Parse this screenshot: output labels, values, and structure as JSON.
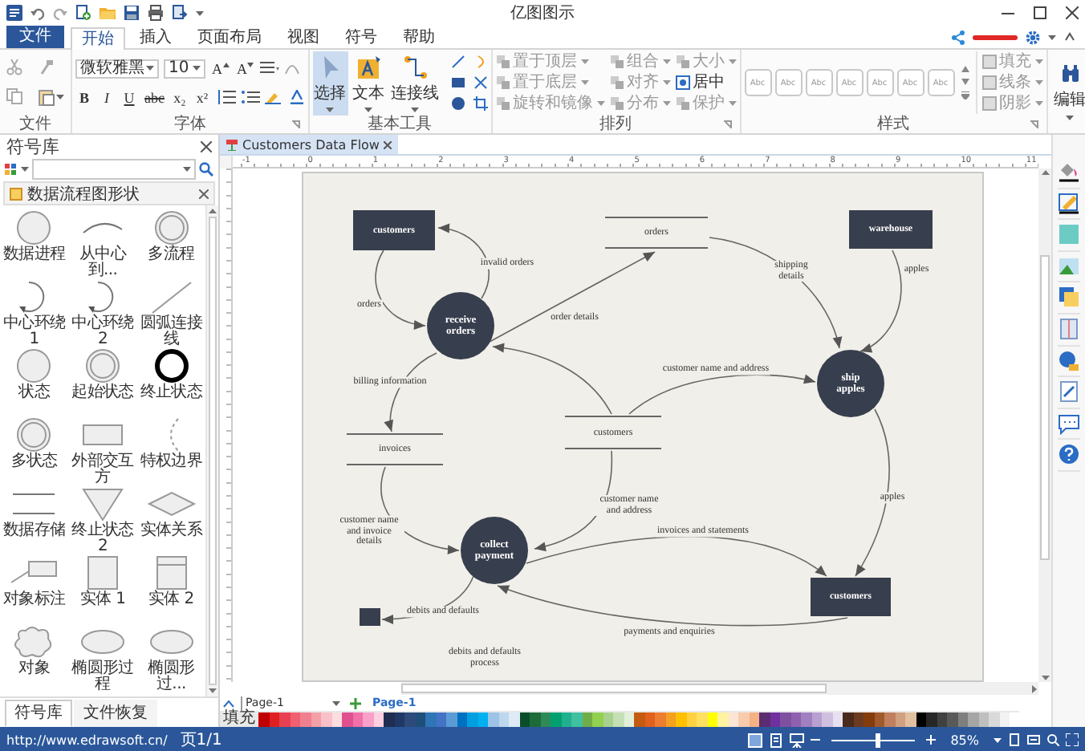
{
  "window": {
    "title": "亿图图示"
  },
  "file_button": "文件",
  "tabs": [
    {
      "label": "开始",
      "selected": true
    },
    {
      "label": "插入",
      "selected": false
    },
    {
      "label": "页面布局",
      "selected": false
    },
    {
      "label": "视图",
      "selected": false
    },
    {
      "label": "符号",
      "selected": false
    },
    {
      "label": "帮助",
      "selected": false
    }
  ],
  "ribbon": {
    "groups": [
      {
        "kind": "clipboard",
        "label": "文件"
      },
      {
        "kind": "font",
        "label": "字体",
        "font_name": "微软雅黑",
        "font_size": "10",
        "size_buttons": [
          "A",
          "A"
        ],
        "format_buttons": [
          "B",
          "I",
          "U",
          "abc",
          "x₂",
          "x²"
        ]
      },
      {
        "kind": "tools",
        "label": "基本工具",
        "tools": [
          {
            "label": "选择",
            "selected": true
          },
          {
            "label": "文本",
            "selected": false
          },
          {
            "label": "连接线",
            "selected": false
          }
        ]
      },
      {
        "kind": "arrange",
        "label": "排列",
        "buttons": [
          {
            "label": "置于顶层",
            "disabled": true,
            "dropdown": true
          },
          {
            "label": "置于底层",
            "disabled": true,
            "dropdown": true
          },
          {
            "label": "旋转和镜像",
            "disabled": true,
            "dropdown": true
          },
          {
            "label": "组合",
            "disabled": true,
            "dropdown": true
          },
          {
            "label": "对齐",
            "disabled": true,
            "dropdown": true
          },
          {
            "label": "分布",
            "disabled": true,
            "dropdown": true
          },
          {
            "label": "大小",
            "disabled": true,
            "dropdown": true
          },
          {
            "label": "居中",
            "disabled": false,
            "dropdown": false
          },
          {
            "label": "保护",
            "disabled": true,
            "dropdown": true
          }
        ]
      },
      {
        "kind": "styles",
        "label": "样式",
        "swatches": [
          "Abc",
          "Abc",
          "Abc",
          "Abc",
          "Abc",
          "Abc",
          "Abc"
        ],
        "format_buttons": [
          {
            "label": "填充",
            "disabled": true
          },
          {
            "label": "线条",
            "disabled": true
          },
          {
            "label": "阴影",
            "disabled": true
          }
        ]
      },
      {
        "kind": "edit",
        "button": "编辑"
      }
    ]
  },
  "library": {
    "title": "符号库",
    "category": "数据流程图形状",
    "shapes": [
      {
        "label": "数据进程",
        "kind": "circle"
      },
      {
        "label": "从中心到...",
        "kind": "arc"
      },
      {
        "label": "多流程",
        "kind": "double-circle"
      },
      {
        "label": "中心环绕 1",
        "kind": "loop"
      },
      {
        "label": "中心环绕 2",
        "kind": "loop"
      },
      {
        "label": "圆弧连接线",
        "kind": "diagonal"
      },
      {
        "label": "状态",
        "kind": "circle"
      },
      {
        "label": "起始状态",
        "kind": "double-circle"
      },
      {
        "label": "终止状态",
        "kind": "thick-circle"
      },
      {
        "label": "多状态",
        "kind": "double-circle"
      },
      {
        "label": "外部交互方",
        "kind": "rect"
      },
      {
        "label": "特权边界",
        "kind": "dashed-arc"
      },
      {
        "label": "数据存储",
        "kind": "store"
      },
      {
        "label": "终止状态 2",
        "kind": "triangle"
      },
      {
        "label": "实体关系",
        "kind": "diamond"
      },
      {
        "label": "对象标注",
        "kind": "callout"
      },
      {
        "label": "实体 1",
        "kind": "square"
      },
      {
        "label": "实体 2",
        "kind": "split-square"
      },
      {
        "label": "对象",
        "kind": "cloud"
      },
      {
        "label": "椭圆形过程",
        "kind": "ellipse"
      },
      {
        "label": "椭圆形过...",
        "kind": "ellipse"
      }
    ],
    "tabs": [
      {
        "label": "符号库",
        "selected": true
      },
      {
        "label": "文件恢复",
        "selected": false
      }
    ]
  },
  "document": {
    "tab": "Customers Data Flow",
    "ruler_labels": [
      "-1",
      "0",
      "1",
      "2",
      "3",
      "4",
      "5",
      "6",
      "7",
      "8",
      "9",
      "10",
      "11"
    ]
  },
  "diagram": {
    "nodes": [
      {
        "kind": "entity",
        "label": "customers"
      },
      {
        "kind": "store",
        "label": "orders"
      },
      {
        "kind": "entity",
        "label": "warehouse"
      },
      {
        "kind": "process",
        "label": "receive orders"
      },
      {
        "kind": "process",
        "label": "ship apples"
      },
      {
        "kind": "store",
        "label": "invoices"
      },
      {
        "kind": "store",
        "label": "customers"
      },
      {
        "kind": "process",
        "label": "collect payment"
      },
      {
        "kind": "entity",
        "label": "customers"
      },
      {
        "kind": "sink"
      }
    ],
    "flows": [
      {
        "label": "orders",
        "arrowhead": true
      },
      {
        "label": "invalid orders",
        "arrowhead": true
      },
      {
        "label": "order details",
        "arrowhead": true
      },
      {
        "label": "shipping details",
        "arrowhead": true
      },
      {
        "label": "apples",
        "arrowhead": true
      },
      {
        "label": "billing information",
        "arrowhead": true
      },
      {
        "arrowhead": true
      },
      {
        "label": "customer name and address",
        "arrowhead": true
      },
      {
        "label": "apples",
        "arrowhead": true
      },
      {
        "label": "customer name and address",
        "arrowhead": true
      },
      {
        "label": "customer name and invoice details",
        "arrowhead": true
      },
      {
        "label": "invoices and statements",
        "arrowhead": true
      },
      {
        "label": "payments and enquiries",
        "arrowhead": true
      },
      {
        "label": "debits and defaults",
        "arrowhead": true
      }
    ],
    "notes": [
      "debits and defaults process"
    ]
  },
  "pages": {
    "selector": "Page-1",
    "tabs": [
      {
        "label": "Page-1",
        "selected": true
      }
    ]
  },
  "palette": {
    "label": "填充",
    "colors": [
      {
        "color": "#c00000"
      },
      {
        "color": "#e02020"
      },
      {
        "color": "#e84050"
      },
      {
        "color": "#f06070"
      },
      {
        "color": "#f08090"
      },
      {
        "color": "#f4a0a8"
      },
      {
        "color": "#f8c0c8"
      },
      {
        "color": "#fcdde0"
      },
      {
        "color": "#e05090"
      },
      {
        "color": "#f070a8"
      },
      {
        "color": "#f8a0c8"
      },
      {
        "color": "#fcd0e0"
      },
      {
        "color": "#1f2d50"
      },
      {
        "color": "#203864"
      },
      {
        "color": "#2e4a7a"
      },
      {
        "color": "#1f4e79"
      },
      {
        "color": "#2e75b6"
      },
      {
        "color": "#4472c4"
      },
      {
        "color": "#5b9bd5"
      },
      {
        "color": "#0070c0"
      },
      {
        "color": "#00a0e0"
      },
      {
        "color": "#00b0f0"
      },
      {
        "color": "#9dc3e6"
      },
      {
        "color": "#bdd7ee"
      },
      {
        "color": "#deebf7"
      },
      {
        "color": "#0b4d2b"
      },
      {
        "color": "#1e6b3a"
      },
      {
        "color": "#2e8b57"
      },
      {
        "color": "#00a070"
      },
      {
        "color": "#20b090"
      },
      {
        "color": "#40c0a0"
      },
      {
        "color": "#70ad47"
      },
      {
        "color": "#92d050"
      },
      {
        "color": "#a9d18e"
      },
      {
        "color": "#c5e0b4"
      },
      {
        "color": "#e2f0d9"
      },
      {
        "color": "#c55a11"
      },
      {
        "color": "#e06020"
      },
      {
        "color": "#ed7d31"
      },
      {
        "color": "#f4a020"
      },
      {
        "color": "#ffc000"
      },
      {
        "color": "#ffd040"
      },
      {
        "color": "#ffe060"
      },
      {
        "color": "#ffff00"
      },
      {
        "color": "#fff2a0"
      },
      {
        "color": "#fbe5d6"
      },
      {
        "color": "#f8cbad"
      },
      {
        "color": "#f4b183"
      },
      {
        "color": "#5b2c6f"
      },
      {
        "color": "#7030a0"
      },
      {
        "color": "#8050a0"
      },
      {
        "color": "#9060b0"
      },
      {
        "color": "#a080c0"
      },
      {
        "color": "#b8a0d0"
      },
      {
        "color": "#d0c0e0"
      },
      {
        "color": "#e8dff0"
      },
      {
        "color": "#4a2a1a"
      },
      {
        "color": "#6b3a20"
      },
      {
        "color": "#843c0c"
      },
      {
        "color": "#a05a2c"
      },
      {
        "color": "#c08060"
      },
      {
        "color": "#d0a080"
      },
      {
        "color": "#e0c0a0"
      },
      {
        "color": "#000000"
      },
      {
        "color": "#262626"
      },
      {
        "color": "#404040"
      },
      {
        "color": "#595959"
      },
      {
        "color": "#7f7f7f"
      },
      {
        "color": "#a5a5a5"
      },
      {
        "color": "#bfbfbf"
      },
      {
        "color": "#d9d9d9"
      },
      {
        "color": "#f2f2f2"
      },
      {
        "color": "#ffffff"
      }
    ]
  },
  "status_bar": {
    "link": "http://www.edrawsoft.cn/",
    "page": "页1/1",
    "zoom": {
      "level": 0.55,
      "reading": "85%"
    }
  }
}
